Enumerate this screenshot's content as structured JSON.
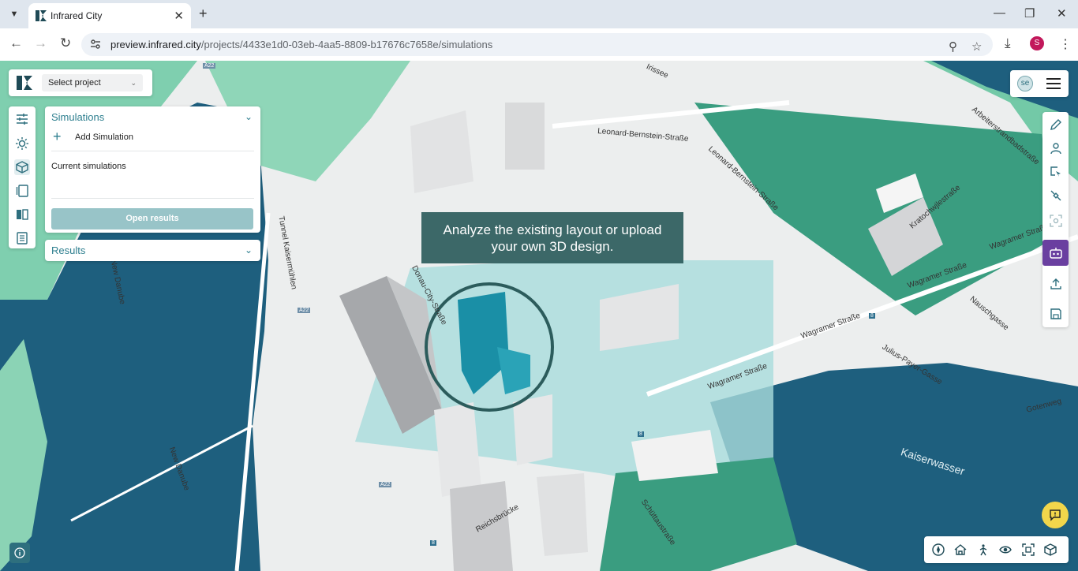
{
  "browser": {
    "tab_title": "Infrared City",
    "url_host": "preview.infrared.city",
    "url_path": "/projects/4433e1d0-03eb-4aa5-8809-b17676c7658e/simulations",
    "profile_initial": "S"
  },
  "app": {
    "project_select": {
      "label": "Select project"
    },
    "left_rail": [
      "sliders-icon",
      "sun-icon",
      "cube-icon",
      "panels-icon",
      "split-view-icon",
      "document-icon"
    ],
    "simulations_panel": {
      "title": "Simulations",
      "add_label": "Add Simulation",
      "current_label": "Current simulations",
      "open_results_label": "Open results"
    },
    "results_panel": {
      "title": "Results"
    },
    "user": {
      "initials": "se"
    },
    "right_rail": [
      "pencil-icon",
      "person-pin-icon",
      "select-area-icon",
      "satellite-icon",
      "scan-icon",
      "bot-icon",
      "upload-icon",
      "save-icon"
    ],
    "bottom_bar": [
      "compass-icon",
      "home-icon",
      "walk-icon",
      "eye-icon",
      "frame-icon",
      "box-icon"
    ],
    "tooltip": {
      "line1": "Analyze the existing layout or upload",
      "line2": "your own 3D design."
    },
    "accent": "#2e7f8f",
    "ai_accent": "#6a3fa0"
  },
  "map": {
    "labels": {
      "irissee": "Irissee",
      "lb_strasse_1": "Leonard-Bernstein-Straße",
      "lb_strasse_2": "Leonard-Bernstein-Straße",
      "arbeiterstrandbad": "Arbeiterstrandbadstraße",
      "kratochwjlestrasse": "Kratochwjlestraße",
      "wagramer_1": "Wagramer Straße",
      "wagramer_2": "Wagramer Straße",
      "wagramer_3": "Wagramer Straße",
      "wagramer_4": "Wagramer Straße",
      "new_danube_1": "New Danube",
      "new_danube_2": "New Danube",
      "tunnel": "Tunnel Kaisermühlen",
      "donau_city": "Donau-City-Straße",
      "reichsbruecke": "Reichsbrücke",
      "schuettau": "Schüttaustraße",
      "kaiserwasser": "Kaiserwasser",
      "julius_payer": "Julius-Payer-Gasse",
      "goetenweg": "Gotenweg",
      "nauschgasse": "Nauschgasse",
      "a22_1": "A22",
      "a22_2": "A22",
      "a22_3": "A22",
      "line8_1": "8",
      "line8_2": "8",
      "line8_3": "8"
    }
  }
}
